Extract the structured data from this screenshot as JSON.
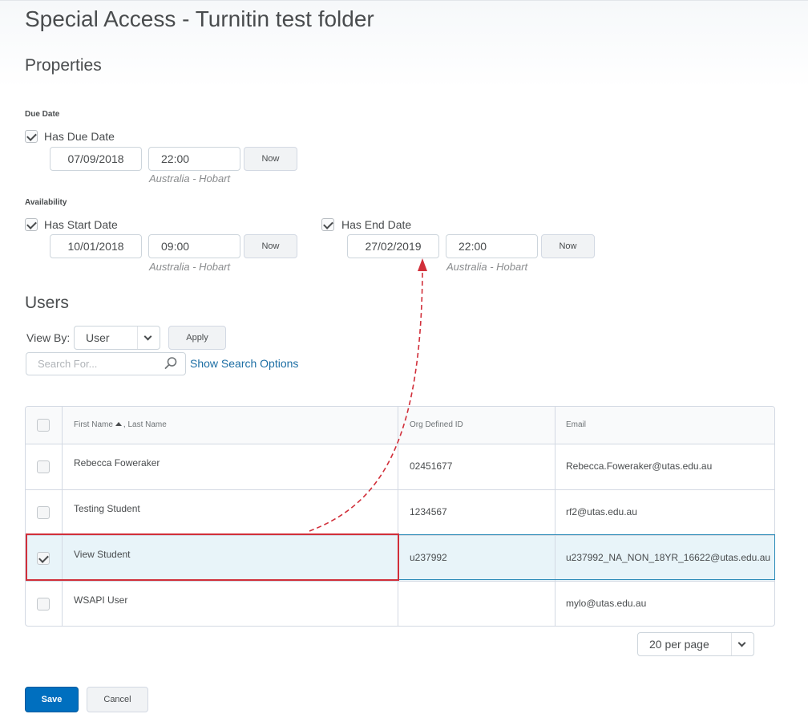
{
  "page": {
    "title": "Special Access - Turnitin test folder"
  },
  "properties": {
    "heading": "Properties",
    "due_date": {
      "section_label": "Due Date",
      "checkbox_label": "Has Due Date",
      "checked": true,
      "date": "07/09/2018",
      "time": "22:00",
      "now_label": "Now",
      "timezone": "Australia - Hobart"
    },
    "availability": {
      "section_label": "Availability",
      "start": {
        "checkbox_label": "Has Start Date",
        "checked": true,
        "date": "10/01/2018",
        "time": "09:00",
        "now_label": "Now",
        "timezone": "Australia - Hobart"
      },
      "end": {
        "checkbox_label": "Has End Date",
        "checked": true,
        "date": "27/02/2019",
        "time": "22:00",
        "now_label": "Now",
        "timezone": "Australia - Hobart"
      }
    }
  },
  "users": {
    "heading": "Users",
    "view_by_label": "View By:",
    "view_by_value": "User",
    "apply_label": "Apply",
    "search_placeholder": "Search For...",
    "show_search_options": "Show Search Options",
    "columns": {
      "first_name": "First Name",
      "last_name": ", Last Name",
      "org_id": "Org Defined ID",
      "email": "Email"
    },
    "rows": [
      {
        "name": "Rebecca Foweraker",
        "org_id": "02451677",
        "email": "Rebecca.Foweraker@utas.edu.au",
        "selected": false
      },
      {
        "name": "Testing Student",
        "org_id": "1234567",
        "email": "rf2@utas.edu.au",
        "selected": false
      },
      {
        "name": "View Student",
        "org_id": "u237992",
        "email": "u237992_NA_NON_18YR_16622@utas.edu.au",
        "selected": true
      },
      {
        "name": "WSAPI User",
        "org_id": "",
        "email": "mylo@utas.edu.au",
        "selected": false
      }
    ],
    "per_page": "20 per page"
  },
  "actions": {
    "save_label": "Save",
    "cancel_label": "Cancel"
  },
  "colors": {
    "accent": "#006fbf",
    "link": "#1c6ea4",
    "highlight_outline": "#d12f3a",
    "selected_row": "#e8f4f9"
  },
  "icons": {
    "search": "search-icon",
    "dropdown": "chevron-down-icon",
    "sort": "sort-ascending-icon",
    "annotation": "dashed-arrow"
  }
}
